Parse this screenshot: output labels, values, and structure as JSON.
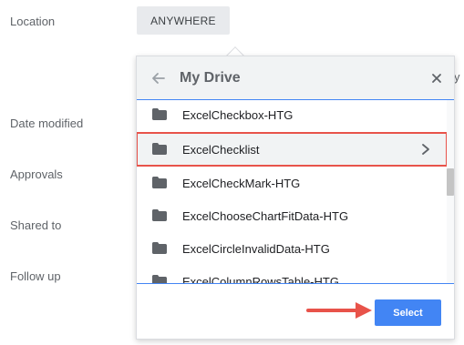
{
  "form": {
    "location_label": "Location",
    "date_modified_label": "Date modified",
    "approvals_label": "Approvals",
    "shared_to_label": "Shared to",
    "follow_up_label": "Follow up",
    "location_value": "ANYWHERE",
    "clipped_text": "y"
  },
  "picker": {
    "title": "My Drive",
    "back_icon": "arrow-left-icon",
    "close_icon": "close-icon",
    "items": [
      {
        "label": "ExcelCheckbox-HTG",
        "icon": "folder-icon"
      },
      {
        "label": "ExcelChecklist",
        "icon": "folder-icon",
        "selected": true
      },
      {
        "label": "ExcelCheckMark-HTG",
        "icon": "folder-icon"
      },
      {
        "label": "ExcelChooseChartFitData-HTG",
        "icon": "folder-icon"
      },
      {
        "label": "ExcelCircleInvalidData-HTG",
        "icon": "folder-icon"
      },
      {
        "label": "ExcelColumnRowsTable-HTG",
        "icon": "folder-icon"
      }
    ],
    "select_label": "Select"
  },
  "colors": {
    "accent": "#4285f4",
    "highlight": "#e8534a",
    "arrow": "#e8534a"
  }
}
